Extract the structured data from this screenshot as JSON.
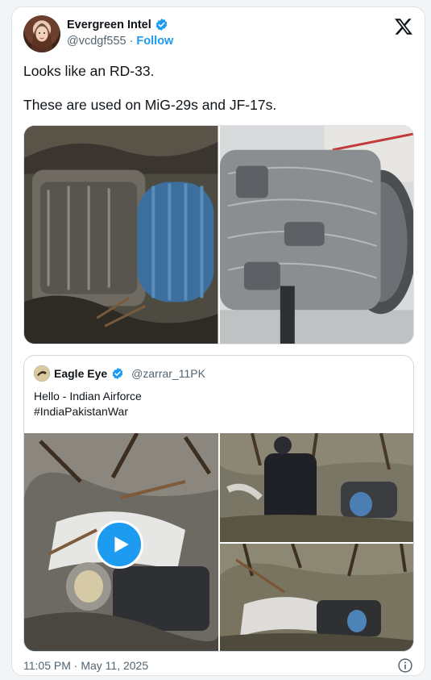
{
  "tweet": {
    "display_name": "Evergreen Intel",
    "handle": "@vcdgf555",
    "separator": "·",
    "follow_label": "Follow",
    "text_lines": [
      "Looks like an RD-33.",
      "These are used on MiG-29s and JF-17s."
    ],
    "timestamp": "11:05 PM · May 11, 2025"
  },
  "quote": {
    "display_name": "Eagle Eye",
    "handle": "@zarrar_11PK",
    "text_lines": [
      "Hello - Indian Airforce",
      "#IndiaPakistanWar"
    ]
  },
  "colors": {
    "accent": "#1d9bf0",
    "secondary_text": "#536471",
    "border": "#cfd9de"
  },
  "icons": {
    "verified": "verified-badge-icon",
    "x_logo": "x-logo-icon",
    "play": "play-icon",
    "info": "info-icon"
  }
}
